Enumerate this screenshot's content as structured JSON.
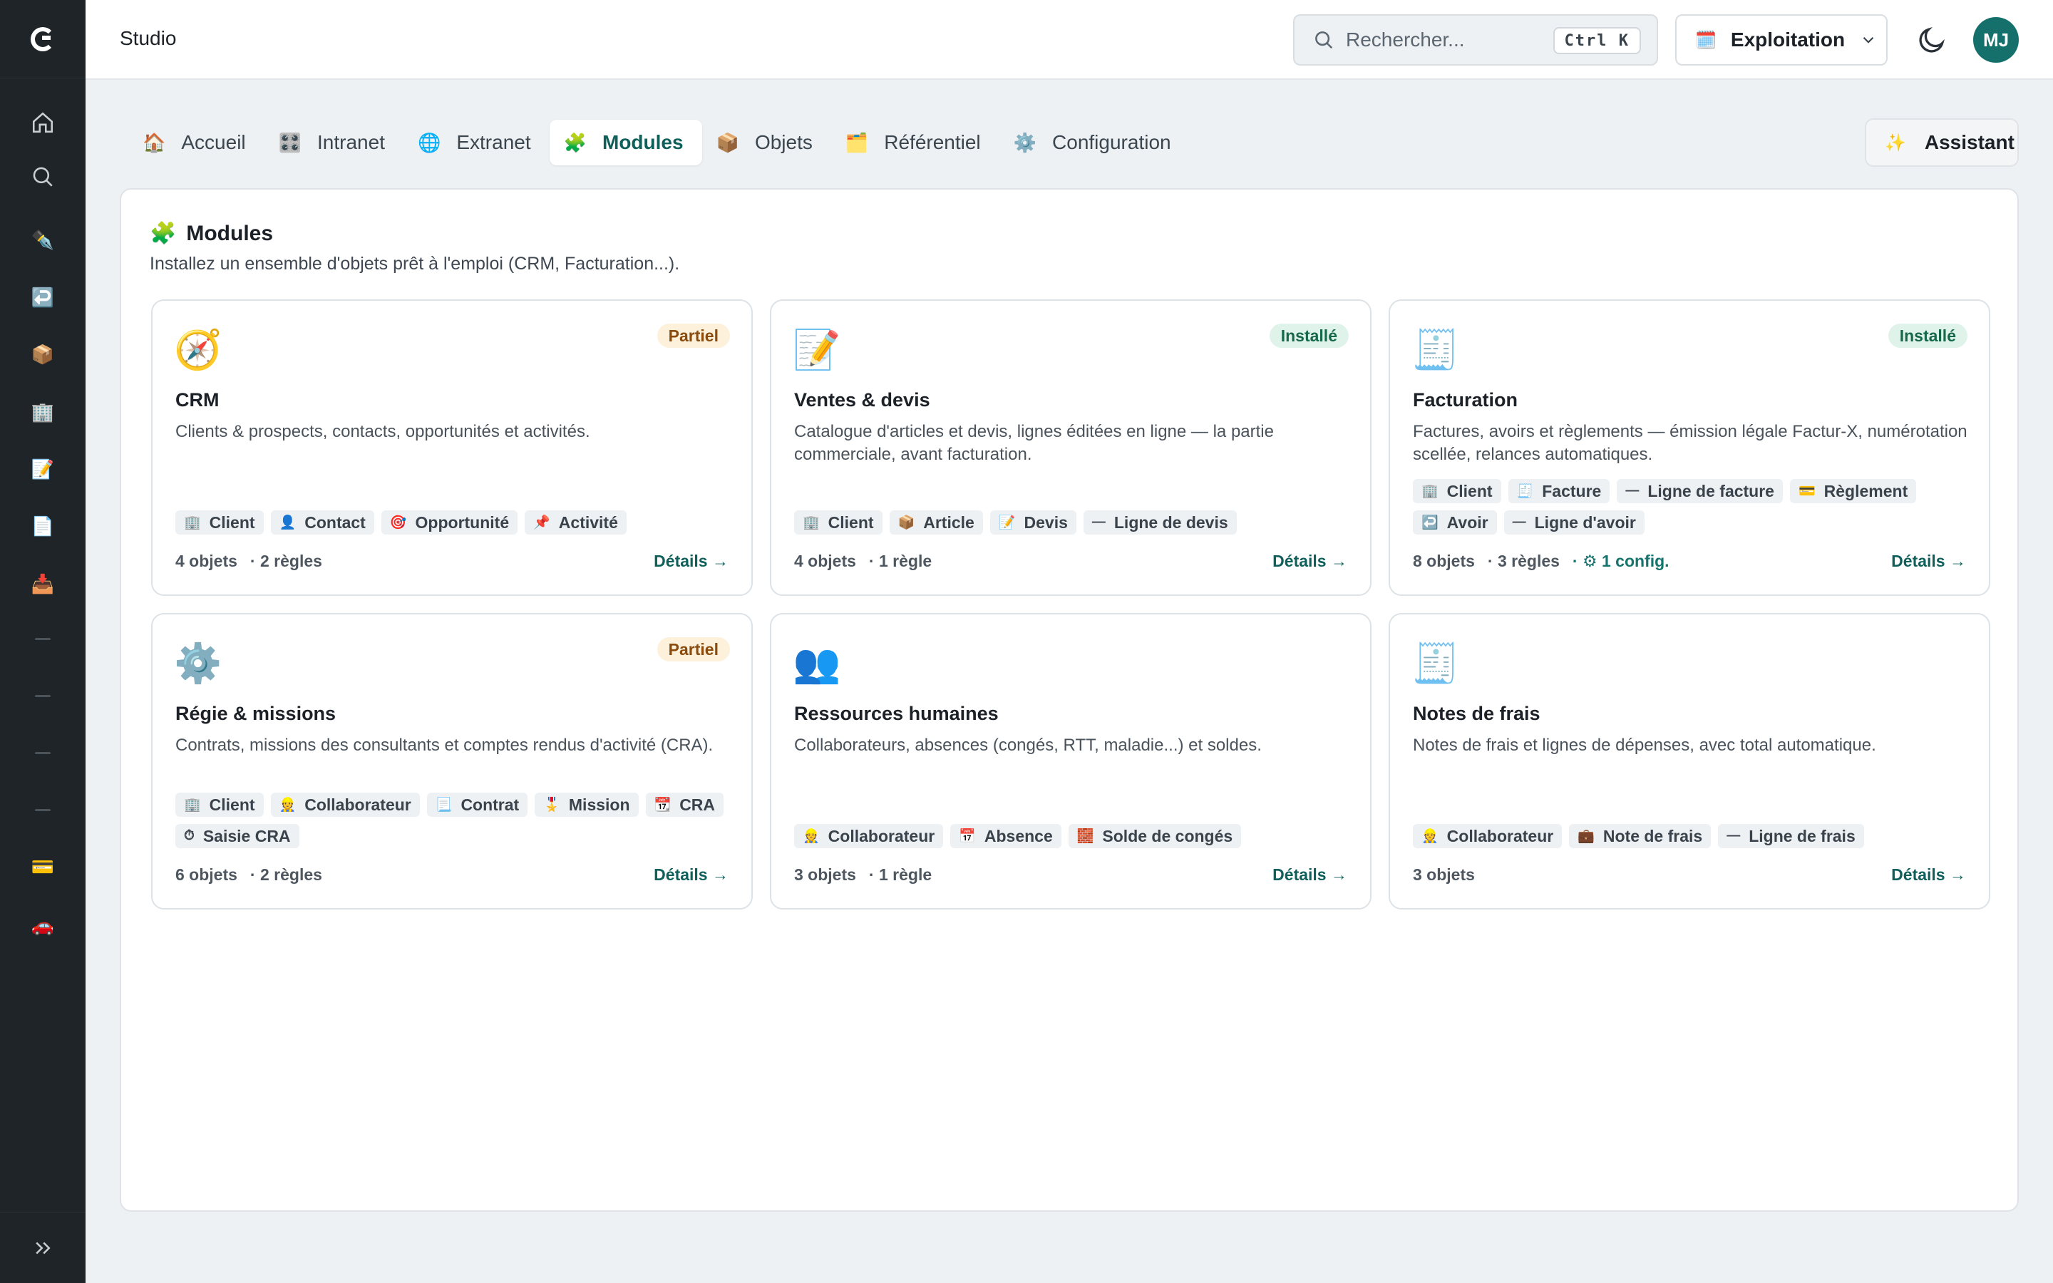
{
  "app": {
    "title": "Studio"
  },
  "header": {
    "search_placeholder": "Rechercher...",
    "search_shortcut": "Ctrl K",
    "environment_label": "Exploitation",
    "avatar_initials": "MJ"
  },
  "tabs": [
    {
      "label": "Accueil",
      "icon": "🏠"
    },
    {
      "label": "Intranet",
      "icon": "🎛️"
    },
    {
      "label": "Extranet",
      "icon": "🌐"
    },
    {
      "label": "Modules",
      "icon": "🧩"
    },
    {
      "label": "Objets",
      "icon": "📦"
    },
    {
      "label": "Référentiel",
      "icon": "🗂️"
    },
    {
      "label": "Configuration",
      "icon": "⚙️"
    }
  ],
  "assistant": {
    "label": "Assistant",
    "icon": "✨"
  },
  "panel": {
    "icon": "🧩",
    "title": "Modules",
    "subtitle": "Installez un ensemble d'objets prêt à l'emploi (CRM, Facturation...)."
  },
  "cards": [
    {
      "icon": "🧭",
      "badge": "Partiel",
      "title": "CRM",
      "description": "Clients & prospects, contacts, opportunités et activités.",
      "chips": [
        {
          "icon": "🏢",
          "label": "Client"
        },
        {
          "icon": "👤",
          "label": "Contact"
        },
        {
          "icon": "🎯",
          "label": "Opportunité"
        },
        {
          "icon": "📌",
          "label": "Activité"
        }
      ],
      "objects": "4 objets",
      "rules": "· 2 règles",
      "config": "",
      "details": "Détails →"
    },
    {
      "icon": "📝",
      "badge": "Installé",
      "title": "Ventes & devis",
      "description": "Catalogue d'articles et devis, lignes éditées en ligne — la partie commerciale, avant facturation.",
      "chips": [
        {
          "icon": "🏢",
          "label": "Client"
        },
        {
          "icon": "📦",
          "label": "Article"
        },
        {
          "icon": "📝",
          "label": "Devis"
        },
        {
          "icon": "—",
          "label": "Ligne de devis"
        }
      ],
      "objects": "4 objets",
      "rules": "· 1 règle",
      "config": "",
      "details": "Détails →"
    },
    {
      "icon": "🧾",
      "badge": "Installé",
      "title": "Facturation",
      "description": "Factures, avoirs et règlements — émission légale Factur-X, numérotation scellée, relances automatiques.",
      "chips": [
        {
          "icon": "🏢",
          "label": "Client"
        },
        {
          "icon": "🧾",
          "label": "Facture"
        },
        {
          "icon": "—",
          "label": "Ligne de facture"
        },
        {
          "icon": "💳",
          "label": "Règlement"
        },
        {
          "icon": "↩️",
          "label": "Avoir"
        },
        {
          "icon": "—",
          "label": "Ligne d'avoir"
        }
      ],
      "objects": "8 objets",
      "rules": "· 3 règles",
      "config": "· ⚙ 1 config.",
      "details": "Détails →"
    },
    {
      "icon": "⚙️",
      "badge": "Partiel",
      "title": "Régie & missions",
      "description": "Contrats, missions des consultants et comptes rendus d'activité (CRA).",
      "chips": [
        {
          "icon": "🏢",
          "label": "Client"
        },
        {
          "icon": "👷",
          "label": "Collaborateur"
        },
        {
          "icon": "📃",
          "label": "Contrat"
        },
        {
          "icon": "🎖️",
          "label": "Mission"
        },
        {
          "icon": "📆",
          "label": "CRA"
        },
        {
          "icon": "⏱",
          "label": "Saisie CRA"
        }
      ],
      "objects": "6 objets",
      "rules": "· 2 règles",
      "config": "",
      "details": "Détails →"
    },
    {
      "icon": "👥",
      "badge": "",
      "title": "Ressources humaines",
      "description": "Collaborateurs, absences (congés, RTT, maladie...) et soldes.",
      "chips": [
        {
          "icon": "👷",
          "label": "Collaborateur"
        },
        {
          "icon": "📅",
          "label": "Absence"
        },
        {
          "icon": "🧱",
          "label": "Solde de congés"
        }
      ],
      "objects": "3 objets",
      "rules": "· 1 règle",
      "config": "",
      "details": "Détails →"
    },
    {
      "icon": "🧾",
      "badge": "",
      "title": "Notes de frais",
      "description": "Notes de frais et lignes de dépenses, avec total automatique.",
      "chips": [
        {
          "icon": "👷",
          "label": "Collaborateur"
        },
        {
          "icon": "💼",
          "label": "Note de frais"
        },
        {
          "icon": "—",
          "label": "Ligne de frais"
        }
      ],
      "objects": "3 objets",
      "rules": "",
      "config": "",
      "details": "Détails →"
    }
  ],
  "sidebar": {
    "items": [
      {
        "icon": "home-icon"
      },
      {
        "icon": "search-icon"
      },
      {
        "icon": "pen-icon"
      },
      {
        "icon": "return-icon"
      },
      {
        "icon": "package-icon"
      },
      {
        "icon": "building-icon"
      },
      {
        "icon": "memo-icon"
      },
      {
        "icon": "document-icon"
      },
      {
        "icon": "inbox-icon"
      },
      {
        "icon": "dash-icon"
      },
      {
        "icon": "dash-icon"
      },
      {
        "icon": "dash-icon"
      },
      {
        "icon": "dash-icon"
      },
      {
        "icon": "credit-card-icon"
      },
      {
        "icon": "car-icon"
      }
    ]
  },
  "colors": {
    "accent": "#0f5f5a",
    "sidebar_bg": "#1f2428",
    "badge_partial_bg": "#fdf1dc",
    "badge_installed_bg": "#dff3ea"
  }
}
